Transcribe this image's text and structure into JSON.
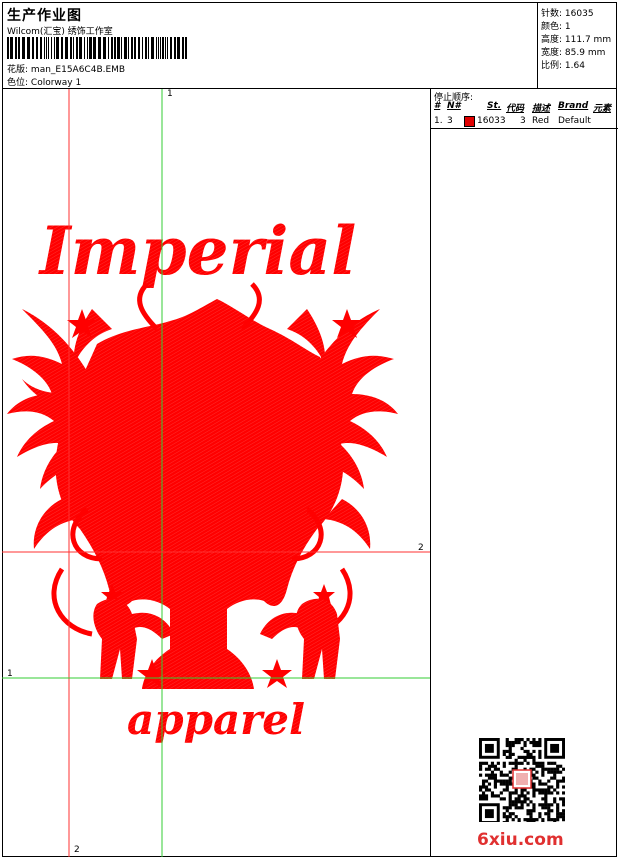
{
  "header": {
    "title": "生产作业图",
    "software": "Wilcom(汇宝) 绣饰工作室",
    "design_file_label": "花版:",
    "design_file": "man_E15A6C4B.EMB",
    "colorway_label": "色位:",
    "colorway": "Colorway 1"
  },
  "specs": {
    "stitches_label": "针数:",
    "stitches": "16035",
    "colors_label": "颜色:",
    "colors": "1",
    "height_label": "高度:",
    "height": "111.7 mm",
    "width_label": "宽度:",
    "width": "85.9 mm",
    "ratio_label": "比例:",
    "ratio": "1.64"
  },
  "stop_sequence": {
    "title": "停止顺序:",
    "columns": [
      "#",
      "N#",
      "St.",
      "代码",
      "描述",
      "Brand",
      "元素"
    ],
    "rows": [
      {
        "index": "1.",
        "needle": "3",
        "stitches": "16033",
        "code": "3",
        "description": "Red",
        "brand": "Default",
        "color": "#e00000"
      }
    ]
  },
  "guides": {
    "vertical_top": "1",
    "horizontal_right": "2",
    "horizontal_left": "1",
    "vertical_bottom": "2"
  },
  "design": {
    "top_text": "Imperial",
    "bottom_text": "apparel",
    "color": "#ff0000"
  },
  "watermark": "6xiu.com"
}
